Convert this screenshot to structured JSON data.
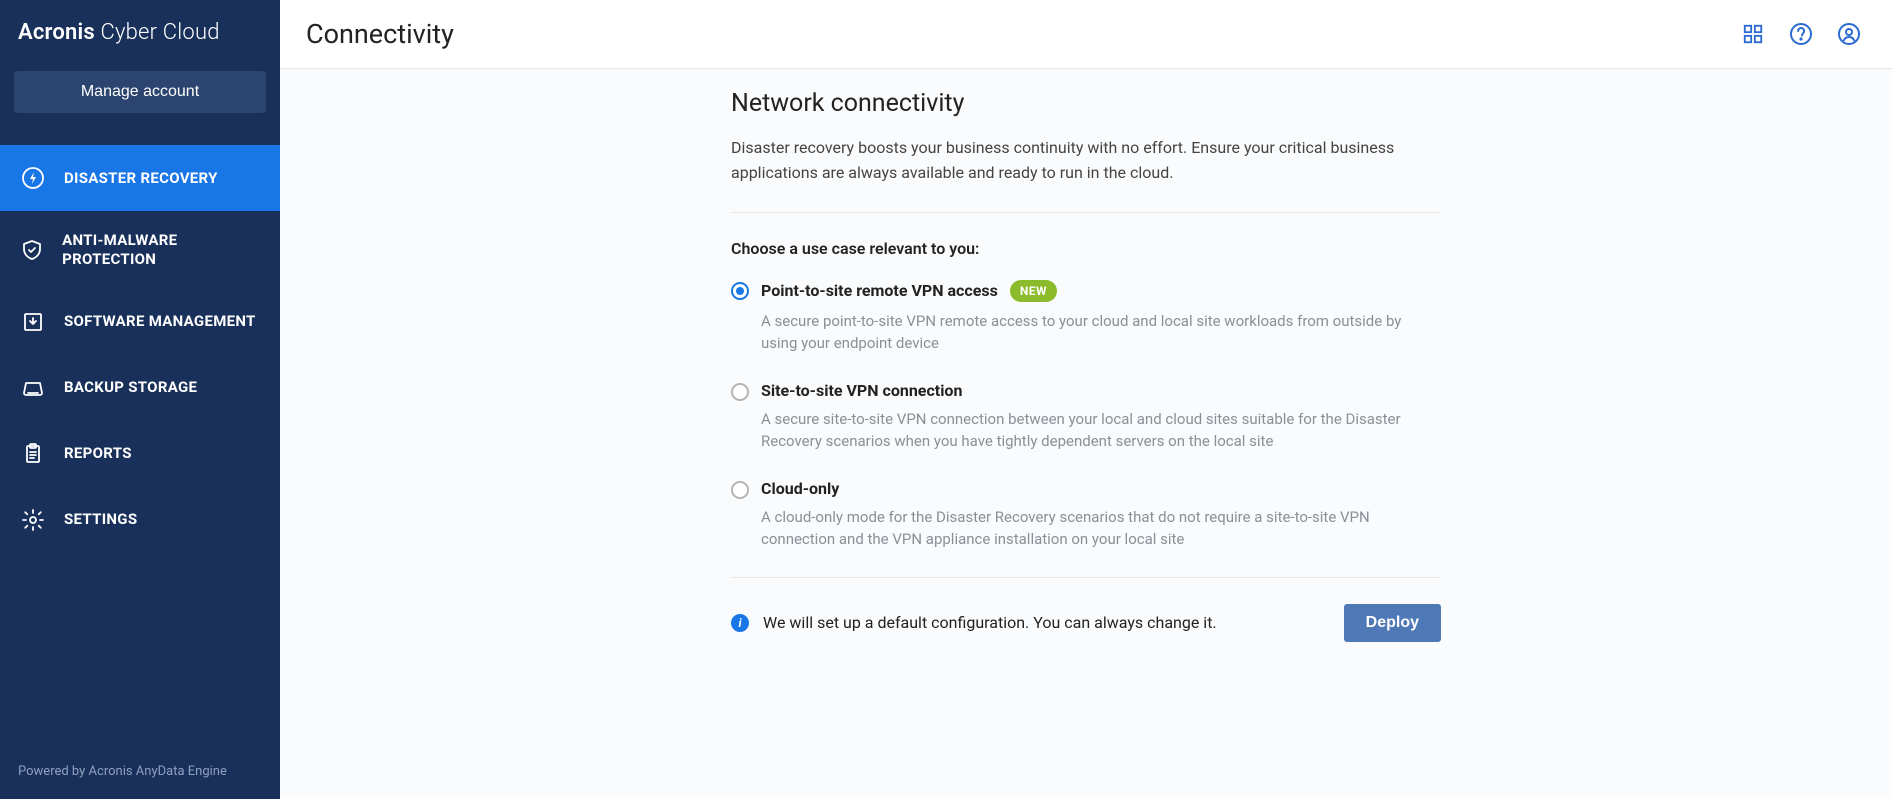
{
  "brand": {
    "bold": "Acronis",
    "light": " Cyber Cloud"
  },
  "sidebar": {
    "manage_label": "Manage account",
    "items": [
      {
        "label": "DISASTER RECOVERY",
        "icon": "bolt-circle",
        "active": true
      },
      {
        "label": "ANTI-MALWARE PROTECTION",
        "icon": "shield-check",
        "active": false
      },
      {
        "label": "SOFTWARE MANAGEMENT",
        "icon": "download-box",
        "active": false
      },
      {
        "label": "BACKUP STORAGE",
        "icon": "disk",
        "active": false
      },
      {
        "label": "REPORTS",
        "icon": "clipboard",
        "active": false
      },
      {
        "label": "SETTINGS",
        "icon": "gear",
        "active": false
      }
    ],
    "footer": "Powered by Acronis AnyData Engine"
  },
  "header": {
    "title": "Connectivity"
  },
  "main": {
    "heading": "Network connectivity",
    "intro": "Disaster recovery boosts your business continuity with no effort. Ensure your critical business applications are always available and ready to run in the cloud.",
    "prompt": "Choose a use case relevant to you:",
    "options": [
      {
        "title": "Point-to-site remote VPN access",
        "badge": "NEW",
        "desc": "A secure point-to-site VPN remote access to your cloud and local site workloads from outside by using your endpoint device",
        "selected": true
      },
      {
        "title": "Site-to-site VPN connection",
        "badge": "",
        "desc": "A secure site-to-site VPN connection between your local and cloud sites suitable for the Disaster Recovery scenarios when you have tightly dependent servers on the local site",
        "selected": false
      },
      {
        "title": "Cloud-only",
        "badge": "",
        "desc": "A cloud-only mode for the Disaster Recovery scenarios that do not require a site-to-site VPN connection and the VPN appliance installation on your local site",
        "selected": false
      }
    ],
    "footer_note": "We will set up a default configuration. You can always change it.",
    "deploy_label": "Deploy"
  }
}
